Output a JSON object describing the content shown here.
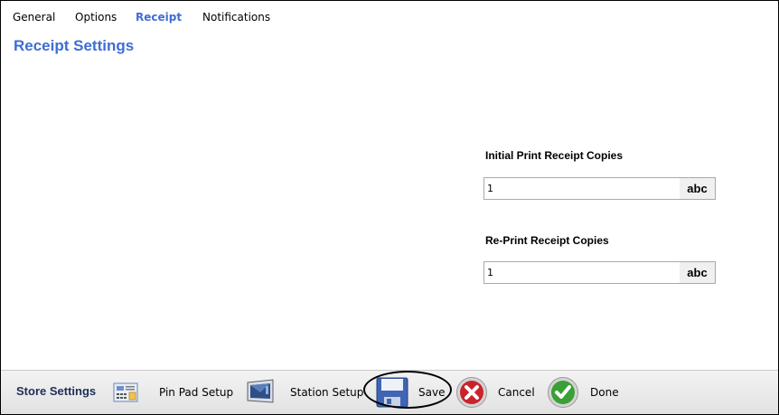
{
  "tabs": [
    {
      "label": "General",
      "active": false
    },
    {
      "label": "Options",
      "active": false
    },
    {
      "label": "Receipt",
      "active": true
    },
    {
      "label": "Notifications",
      "active": false
    }
  ],
  "page_title": "Receipt Settings",
  "fields": {
    "initial": {
      "label": "Initial Print Receipt Copies",
      "value": "1",
      "button": "abc"
    },
    "reprint": {
      "label": "Re-Print Receipt Copies",
      "value": "1",
      "button": "abc"
    }
  },
  "bottom_bar": {
    "title": "Store Settings",
    "pin_pad": {
      "label": "Pin Pad Setup",
      "icon": "pin-pad-icon"
    },
    "station": {
      "label": "Station Setup",
      "icon": "monitor-icon"
    },
    "save": {
      "label": "Save",
      "icon": "floppy-disk-icon"
    },
    "cancel": {
      "label": "Cancel",
      "icon": "cancel-x-icon"
    },
    "done": {
      "label": "Done",
      "icon": "checkmark-icon"
    }
  },
  "colors": {
    "accent": "#3f6dd6",
    "cancel": "#c9242c",
    "done": "#3aa035"
  }
}
